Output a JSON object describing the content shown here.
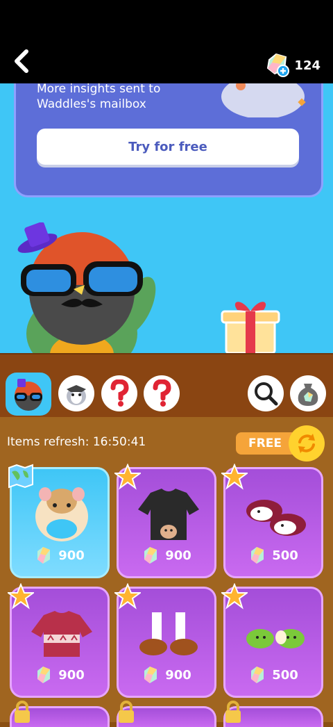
{
  "header": {
    "gem_count": "124",
    "icons": [
      "back-chevron-icon",
      "gem-plus-icon"
    ]
  },
  "promo": {
    "text": "More insights sent to Waddles's mailbox",
    "button_label": "Try for free"
  },
  "tabs": {
    "icons": [
      "bird-avatar-icon",
      "penguin-avatar-icon",
      "question-icon",
      "question-icon",
      "search-icon",
      "gem-bag-icon"
    ]
  },
  "shop": {
    "refresh_text": "Items refresh: 16:50:41",
    "free_label": "FREE",
    "items": [
      {
        "item": "hat",
        "price": "900",
        "badge": "map-icon",
        "color": "blue"
      },
      {
        "item": "sweater",
        "price": "900",
        "badge": "star-icon",
        "color": "purple"
      },
      {
        "item": "slippers",
        "price": "500",
        "badge": "star-icon",
        "color": "purple"
      },
      {
        "item": "knit-sweater",
        "price": "900",
        "badge": "star-icon",
        "color": "purple"
      },
      {
        "item": "shoes",
        "price": "900",
        "badge": "star-icon",
        "color": "purple"
      },
      {
        "item": "apple-slippers",
        "price": "500",
        "badge": "star-icon",
        "color": "purple"
      }
    ]
  },
  "colors": {
    "sky": "#3fc6f6",
    "promo": "#5d6ed8",
    "card_purple": "#b95ee8",
    "wood": "#a06520"
  }
}
